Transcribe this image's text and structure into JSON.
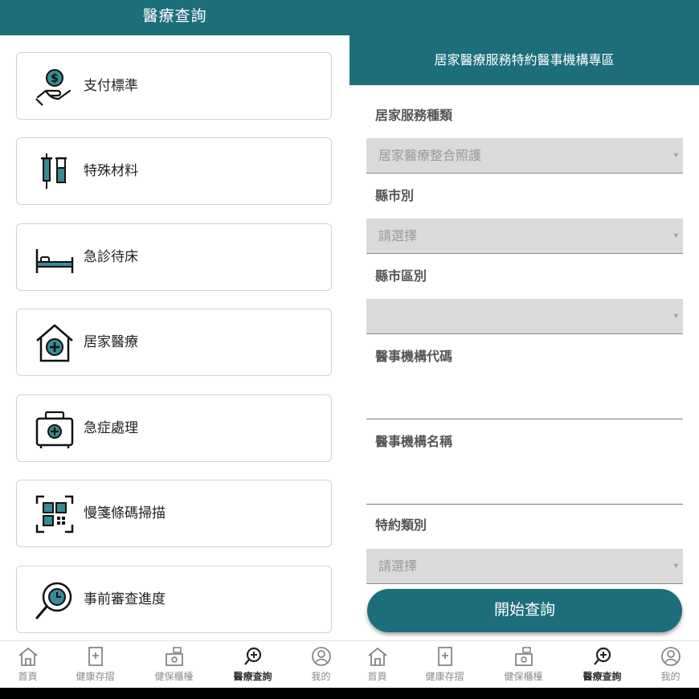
{
  "left": {
    "title": "醫療查詢",
    "menu": [
      {
        "label": "支付標準",
        "icon": "payment-hand-icon"
      },
      {
        "label": "特殊材料",
        "icon": "syringe-vials-icon"
      },
      {
        "label": "急診待床",
        "icon": "bed-icon"
      },
      {
        "label": "居家醫療",
        "icon": "home-medical-icon"
      },
      {
        "label": "急症處理",
        "icon": "first-aid-kit-icon"
      },
      {
        "label": "慢箋條碼掃描",
        "icon": "qr-scan-icon"
      },
      {
        "label": "事前審查進度",
        "icon": "search-clock-icon"
      }
    ]
  },
  "right": {
    "title": "居家醫療服務特約醫事機構專區",
    "service_type": {
      "label": "居家服務種類",
      "value": "居家醫療整合照護"
    },
    "county": {
      "label": "縣市別",
      "value": "請選擇"
    },
    "district": {
      "label": "縣市區別",
      "value": ""
    },
    "org_code": {
      "label": "醫事機構代碼",
      "value": ""
    },
    "org_name": {
      "label": "醫事機構名稱",
      "value": ""
    },
    "contract_type": {
      "label": "特約類別",
      "value": "請選擇"
    },
    "search_button": "開始查詢",
    "dropdown_arrow": "▾"
  },
  "tabbar": [
    {
      "label": "首頁",
      "icon": "home-icon"
    },
    {
      "label": "健康存摺",
      "icon": "health-book-icon"
    },
    {
      "label": "健保櫃檯",
      "icon": "counter-icon"
    },
    {
      "label": "醫療查詢",
      "icon": "medical-search-icon",
      "active": true
    },
    {
      "label": "我的",
      "icon": "profile-icon"
    }
  ],
  "colors": {
    "primary": "#1d6e7b",
    "icon_teal": "#3a8a95",
    "select_bg": "#dadada"
  }
}
